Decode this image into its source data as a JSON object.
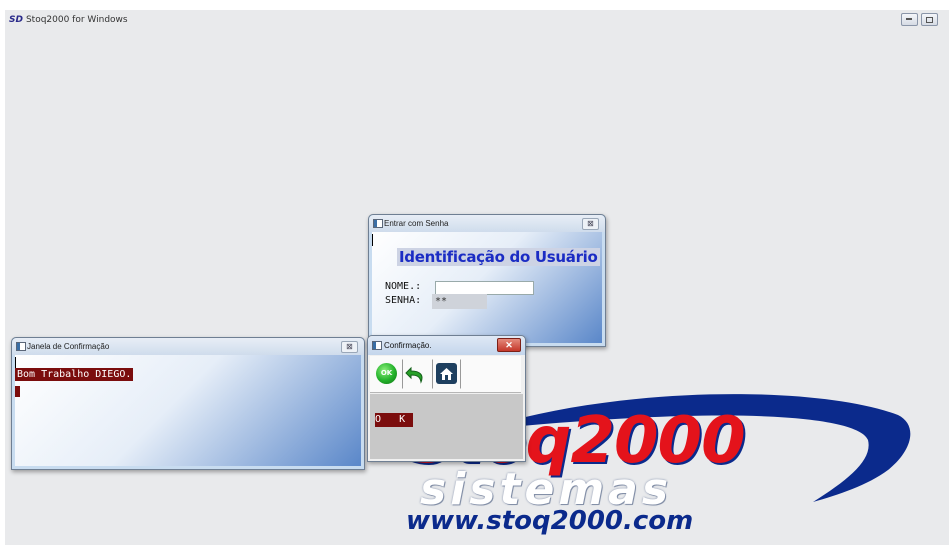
{
  "app": {
    "title": "Stoq2000 for Windows",
    "logo_glyph": "SD"
  },
  "login_window": {
    "title": "Entrar com Senha",
    "close": "⊠",
    "heading": "Identificação do Usuário",
    "name_label": "NOME.:",
    "name_value": "",
    "password_label": "SENHA:",
    "password_value": "**"
  },
  "confirm_window": {
    "title": "Janela de Confirmação",
    "close": "⊠",
    "message": "Bom Trabalho DIEGO."
  },
  "confirmation_dialog": {
    "title": "Confirmação.",
    "close": "✕",
    "ok_icon_text": "OK",
    "field_text": "O   K"
  },
  "brand": {
    "name": "Stoq2000",
    "tagline": "sistemas",
    "url": "www.stoq2000.com"
  },
  "colors": {
    "brand_red": "#e4131b",
    "brand_blue": "#0b2a8c",
    "field_maroon": "#7b0d0d",
    "heading_blue": "#1b2cc4"
  }
}
